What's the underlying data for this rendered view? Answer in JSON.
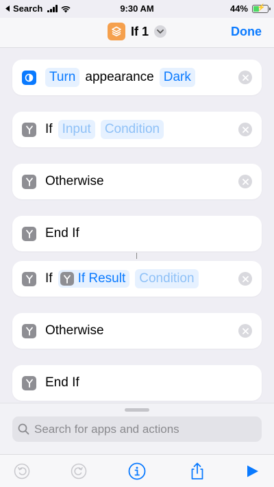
{
  "status_bar": {
    "back_label": "Search",
    "time": "9:30 AM",
    "battery": "44%",
    "battery_level": 0.44
  },
  "nav": {
    "title": "If 1",
    "done_label": "Done"
  },
  "actions": [
    {
      "type": "set-appearance",
      "parts": [
        "Turn",
        "appearance",
        "Dark"
      ]
    },
    {
      "type": "if",
      "keyword": "If",
      "input": "Input",
      "condition": "Condition"
    },
    {
      "type": "otherwise",
      "keyword": "Otherwise"
    },
    {
      "type": "end-if",
      "keyword": "End If"
    },
    {
      "type": "if",
      "keyword": "If",
      "variable": "If Result",
      "condition": "Condition"
    },
    {
      "type": "otherwise",
      "keyword": "Otherwise"
    },
    {
      "type": "end-if",
      "keyword": "End If"
    }
  ],
  "search": {
    "placeholder": "Search for apps and actions"
  },
  "toolbar": {
    "icons": [
      "undo-icon",
      "redo-icon",
      "info-icon",
      "share-icon",
      "play-icon"
    ]
  },
  "colors": {
    "accent": "#0a7aff",
    "app_icon": "#f5a04d",
    "token_bg": "#e6f1ff",
    "scripting_glyph": "#8e8e93"
  }
}
